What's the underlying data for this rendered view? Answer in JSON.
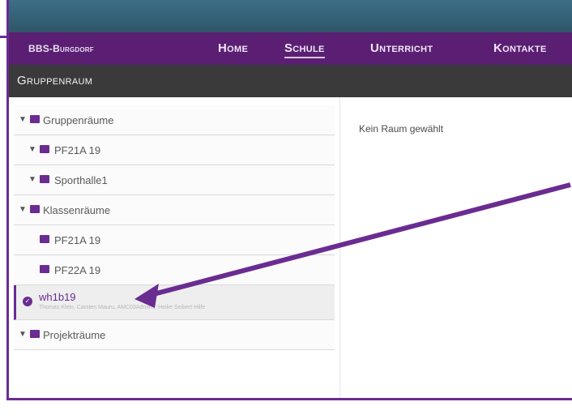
{
  "nav": {
    "brand": "BBS-Burgdorf",
    "items": [
      "Home",
      "Schule",
      "Unterricht",
      "Kontakte"
    ],
    "active_index": 1
  },
  "title": "Gruppenraum",
  "tree": [
    {
      "label": "Gruppenräume",
      "level": 0,
      "expanded": true
    },
    {
      "label": "PF21A 19",
      "level": 1,
      "expanded": true
    },
    {
      "label": "Sporthalle1",
      "level": 1,
      "expanded": true
    },
    {
      "label": "Klassenräume",
      "level": 0,
      "expanded": true
    },
    {
      "label": "PF21A 19",
      "level": 1,
      "expanded": false
    },
    {
      "label": "PF22A 19",
      "level": 1,
      "expanded": false
    },
    {
      "label": "wh1b19",
      "level": 1,
      "selected": true,
      "sub": "Thomas Klein, Carsten Mauru, AMC03Admins, Heike Seibert-Hilfe"
    },
    {
      "label": "Projekträume",
      "level": 0,
      "expanded": true
    }
  ],
  "content": {
    "message": "Kein Raum gewählt"
  },
  "colors": {
    "accent": "#6a2c91",
    "navbar": "#5a1f72",
    "titlebar": "#3a3a3a"
  }
}
